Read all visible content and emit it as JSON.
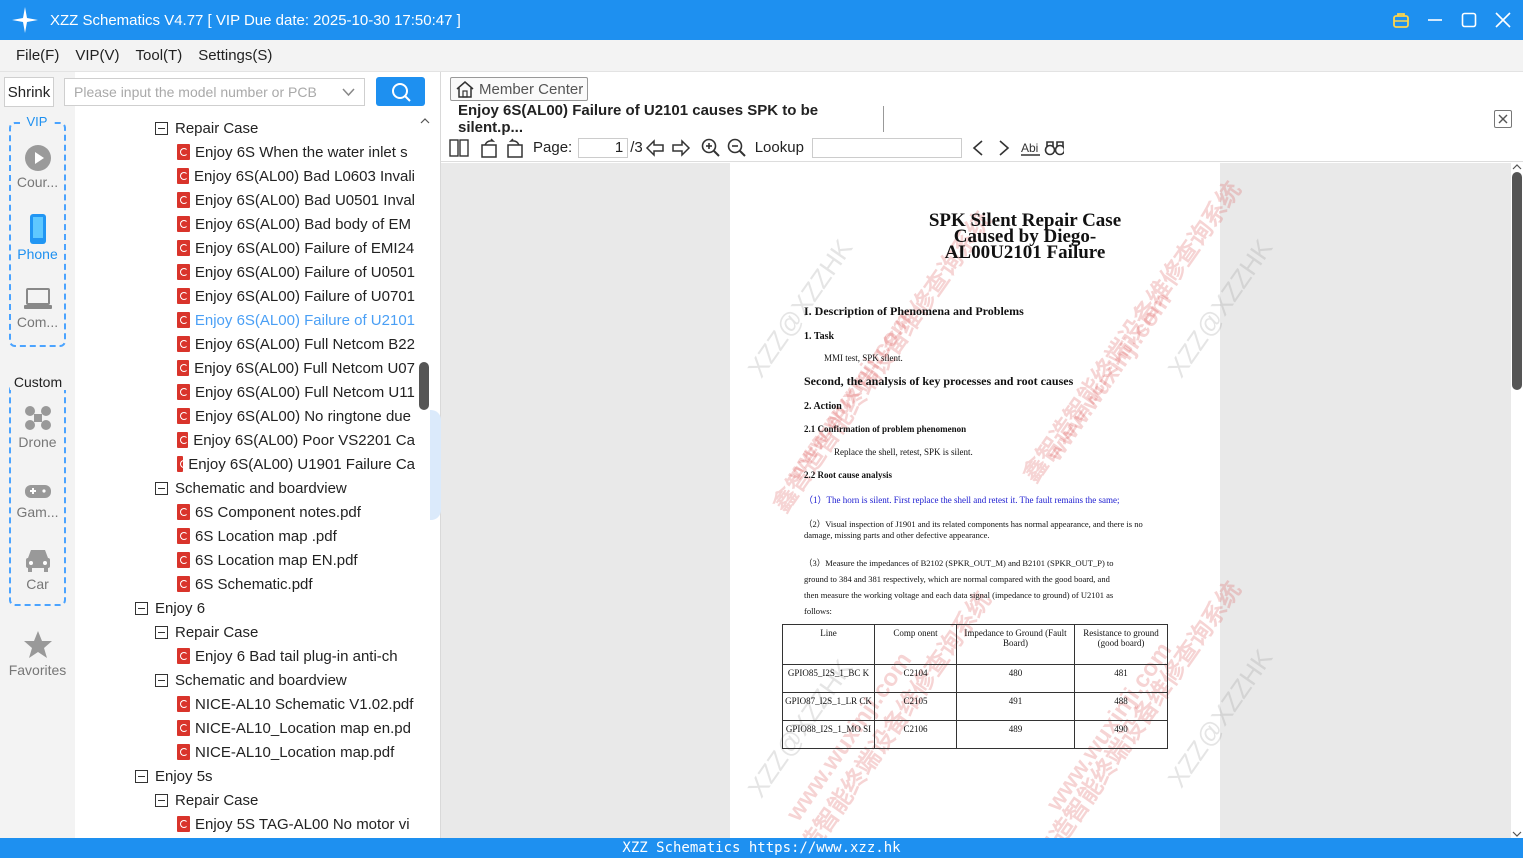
{
  "titlebar": {
    "title": "XZZ Schematics V4.77 [ VIP Due date: 2025-10-30 17:50:47 ]"
  },
  "menu": {
    "items": [
      "File(F)",
      "VIP(V)",
      "Tool(T)",
      "Settings(S)"
    ]
  },
  "left": {
    "shrink_label": "Shrink",
    "vip_label": "VIP",
    "custom_label": "Custom",
    "items": {
      "course": "Cour...",
      "phone": "Phone",
      "computer": "Com...",
      "drone": "Drone",
      "game": "Gam...",
      "car": "Car",
      "favorites": "Favorites"
    }
  },
  "search": {
    "placeholder": "Please input the model number or PCB"
  },
  "tree": {
    "rows": [
      {
        "type": "folder",
        "level": 1,
        "label": "Repair Case"
      },
      {
        "type": "pdf",
        "label": "Enjoy 6S When the water inlet s"
      },
      {
        "type": "pdf",
        "label": "Enjoy 6S(AL00) Bad L0603 Invali"
      },
      {
        "type": "pdf",
        "label": "Enjoy 6S(AL00) Bad U0501 Inval"
      },
      {
        "type": "pdf",
        "label": "Enjoy 6S(AL00) Bad body of EM"
      },
      {
        "type": "pdf",
        "label": "Enjoy 6S(AL00) Failure of EMI24"
      },
      {
        "type": "pdf",
        "label": "Enjoy 6S(AL00) Failure of U0501"
      },
      {
        "type": "pdf",
        "label": "Enjoy 6S(AL00) Failure of U0701"
      },
      {
        "type": "pdf",
        "label": "Enjoy 6S(AL00) Failure of U2101",
        "selected": true
      },
      {
        "type": "pdf",
        "label": "Enjoy 6S(AL00) Full Netcom B22"
      },
      {
        "type": "pdf",
        "label": "Enjoy 6S(AL00) Full Netcom U07"
      },
      {
        "type": "pdf",
        "label": "Enjoy 6S(AL00) Full Netcom U11"
      },
      {
        "type": "pdf",
        "label": "Enjoy 6S(AL00) No ringtone due"
      },
      {
        "type": "pdf",
        "label": "Enjoy 6S(AL00) Poor VS2201 Ca"
      },
      {
        "type": "pdf",
        "label": "Enjoy 6S(AL00) U1901 Failure Ca"
      },
      {
        "type": "folder",
        "level": 1,
        "label": "Schematic and boardview"
      },
      {
        "type": "pdf",
        "label": "6S Component notes.pdf"
      },
      {
        "type": "pdf",
        "label": "6S Location map .pdf"
      },
      {
        "type": "pdf",
        "label": "6S Location map EN.pdf"
      },
      {
        "type": "pdf",
        "label": "6S Schematic.pdf"
      },
      {
        "type": "folder",
        "level": 0,
        "label": "Enjoy 6"
      },
      {
        "type": "folder",
        "level": 1,
        "label": "Repair Case"
      },
      {
        "type": "pdf",
        "label": "Enjoy 6 Bad tail plug-in anti-ch"
      },
      {
        "type": "folder",
        "level": 1,
        "label": "Schematic and boardview"
      },
      {
        "type": "pdf",
        "label": "NICE-AL10 Schematic V1.02.pdf"
      },
      {
        "type": "pdf",
        "label": "NICE-AL10_Location map en.pd"
      },
      {
        "type": "pdf",
        "label": "NICE-AL10_Location map.pdf"
      },
      {
        "type": "folder",
        "level": 0,
        "label": "Enjoy 5s"
      },
      {
        "type": "folder",
        "level": 1,
        "label": "Repair Case"
      },
      {
        "type": "pdf",
        "label": "Enjoy 5S TAG-AL00 No motor vi"
      }
    ]
  },
  "right": {
    "member_center": "Member Center",
    "doc_tab": "Enjoy 6S(AL00) Failure of U2101 causes SPK to be silent.p...",
    "toolbar": {
      "page_label": "Page:",
      "page_value": "1",
      "page_total": "/3",
      "lookup_label": "Lookup"
    }
  },
  "pdf": {
    "title_lines": [
      "SPK Silent Repair Case",
      "Caused by Diego-",
      "AL00U2101 Failure"
    ],
    "h1": "I. Description of Phenomena and Problems",
    "task_h": "1. Task",
    "task_text": "MMI test, SPK silent.",
    "h2": "Second, the analysis of key processes and root causes",
    "action_h": "2. Action",
    "s21_h": "2.1  Confirmation of problem phenomenon",
    "s21_text": "Replace the shell, retest, SPK is silent.",
    "s22_h": "2.2  Root cause analysis",
    "p1_num": "（1）",
    "p1": "The horn is silent. First replace the shell and retest it. The fault remains the same;",
    "p2_num": "（2）",
    "p2a": "Visual inspection of J1901 and its related components has normal appearance, and there is no",
    "p2b": "damage, missing parts and other defective appearance.",
    "p3_num": "（3）",
    "p3a": "Measure the impedances of B2102 (SPKR_OUT_M) and B2101 (SPKR_OUT_P) to",
    "p3b": "ground to 384 and 381 respectively, which are normal compared with the good board, and",
    "p3c": "then measure the working voltage and each data signal (impedance to ground) of U2101 as",
    "p3d": "follows:",
    "table": {
      "headers": [
        "Line",
        "Comp onent",
        "Impedance to Ground (Fault Board)",
        "Resistance to ground (good board)"
      ],
      "rows": [
        [
          "GPIO85_I2S_1_BC K",
          "C2104",
          "480",
          "481"
        ],
        [
          "GPIO87_I2S_1_LR CK",
          "C2105",
          "491",
          "488"
        ],
        [
          "GPIO88_I2S_1_MO SI",
          "C2106",
          "489",
          "490"
        ]
      ]
    },
    "watermarks": {
      "a": "XZZ@XZZHK",
      "b": "鑫智造智能终端设备维修查询系统",
      "c": "www.wuxinji.com"
    }
  },
  "status": {
    "text": "XZZ Schematics https://www.xzz.hk"
  },
  "colors": {
    "accent": "#1e90f0",
    "selected": "#4a9ff5",
    "pdf_icon": "#d9342b"
  }
}
